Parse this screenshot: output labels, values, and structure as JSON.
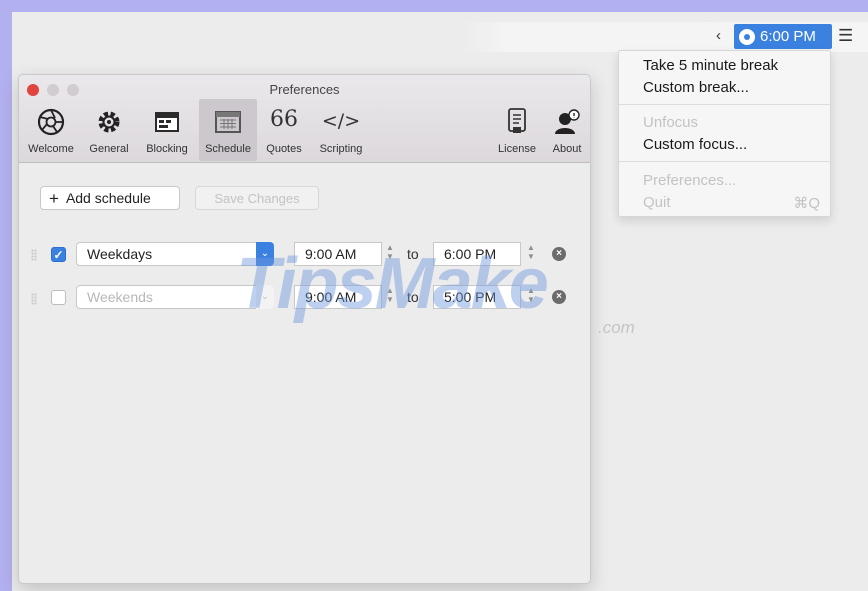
{
  "menubar": {
    "chevron": "‹",
    "clock_time": "6:00 PM",
    "list_icon": "list-icon"
  },
  "menu": {
    "items": [
      {
        "label": "Take 5 minute break",
        "enabled": true
      },
      {
        "label": "Custom break...",
        "enabled": true
      },
      {
        "label": "Unfocus",
        "enabled": false
      },
      {
        "label": "Custom focus...",
        "enabled": true
      },
      {
        "label": "Preferences...",
        "enabled": false
      },
      {
        "label": "Quit",
        "enabled": false,
        "shortcut": "⌘Q"
      }
    ]
  },
  "window": {
    "title": "Preferences",
    "toolbar": [
      {
        "label": "Welcome",
        "icon": "aperture-icon"
      },
      {
        "label": "General",
        "icon": "gear-icon"
      },
      {
        "label": "Blocking",
        "icon": "blocking-icon"
      },
      {
        "label": "Schedule",
        "icon": "calendar-icon",
        "selected": true
      },
      {
        "label": "Quotes",
        "icon": "quotes-icon",
        "glyph": "66"
      },
      {
        "label": "Scripting",
        "icon": "code-icon",
        "glyph": "</>"
      },
      {
        "label": "License",
        "icon": "license-icon"
      },
      {
        "label": "About",
        "icon": "person-icon"
      }
    ],
    "add_schedule_label": "Add schedule",
    "add_symbol": "+",
    "save_changes_label": "Save Changes",
    "schedules": [
      {
        "enabled": true,
        "days": "Weekdays",
        "start": "9:00 AM",
        "to": "to",
        "end": "6:00 PM"
      },
      {
        "enabled": false,
        "days": "Weekends",
        "start": "9:00 AM",
        "to": "to",
        "end": "5:00 PM"
      }
    ]
  },
  "watermark": {
    "text": "TipsMake",
    "suffix": ".com"
  },
  "colors": {
    "accent": "#3b82e0",
    "close": "#e0443e",
    "desktop_border": "#b3b0ef"
  }
}
